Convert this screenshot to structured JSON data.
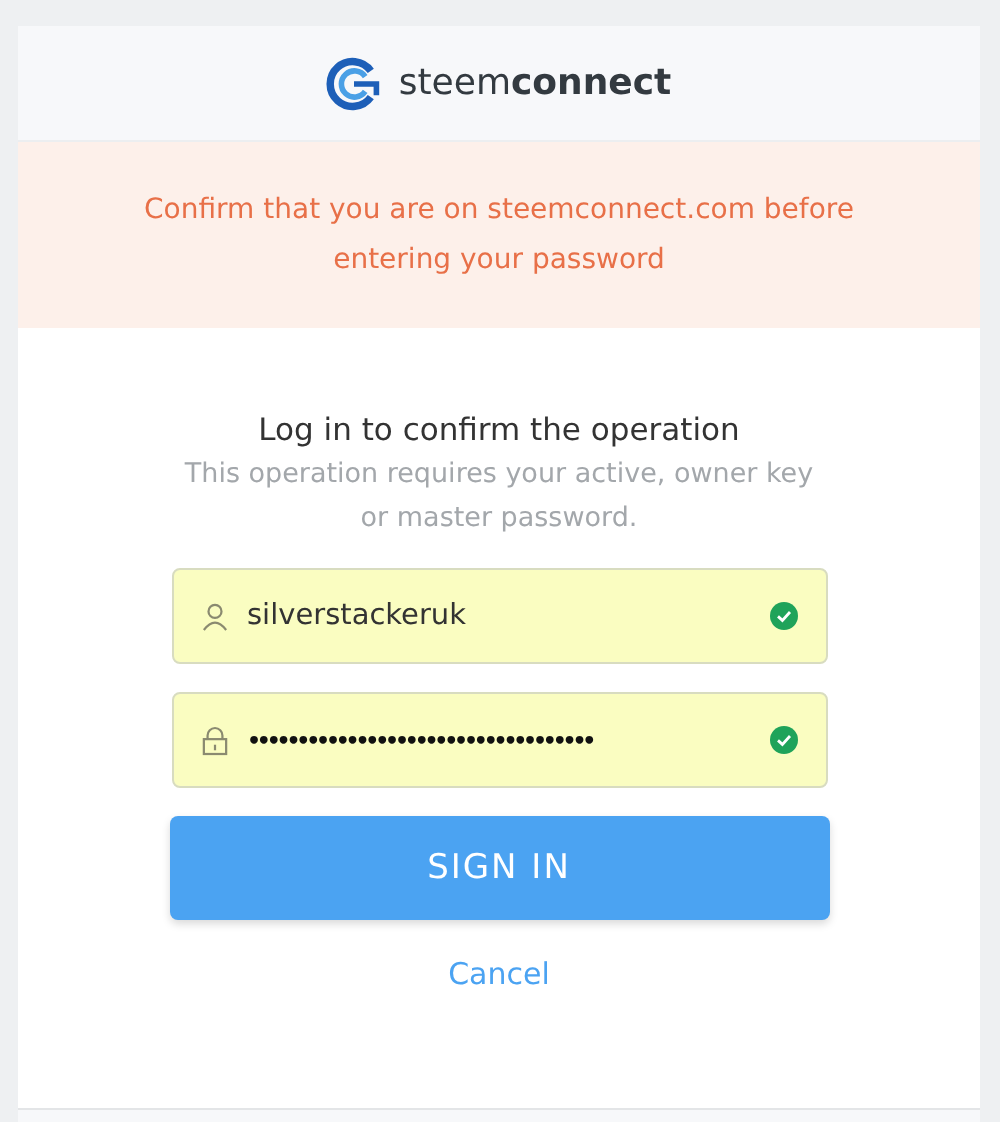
{
  "header": {
    "brand_light": "steem",
    "brand_bold": "connect"
  },
  "warning": "Confirm that you are on steemconnect.com before entering your password",
  "title": "Log in to confirm the operation",
  "subtitle": "This operation requires your active, owner key or master password.",
  "fields": [
    {
      "kind": "user",
      "value": "silverstackeruk",
      "valid": true
    },
    {
      "kind": "password",
      "value": "•••••••••••••••••••••••••••••••••••",
      "valid": true
    }
  ],
  "submit": "SIGN IN",
  "cancel": "Cancel"
}
